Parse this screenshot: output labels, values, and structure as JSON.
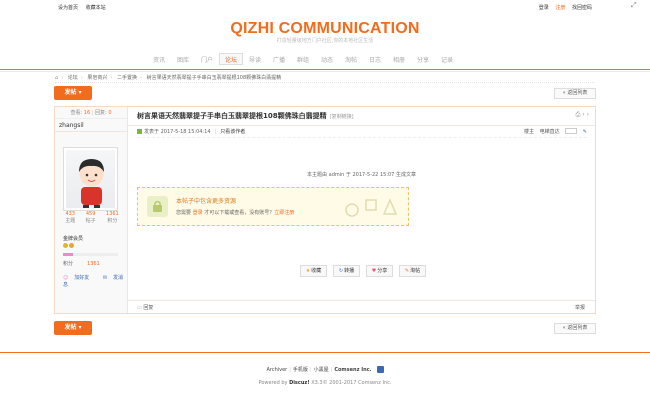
{
  "topbar": {
    "set_home": "设为首页",
    "favorite": "收藏本站",
    "login": "登录",
    "register": "注册",
    "forgot": "找回密码"
  },
  "brand": {
    "logo": "QIZHI COMMUNICATION",
    "tagline": "打造轻量级地方门户社区,你的本地社区生活"
  },
  "nav": [
    "资讯",
    "图库",
    "门户",
    "论坛",
    "导读",
    "广播",
    "群组",
    "动态",
    "淘帖",
    "日志",
    "相册",
    "分享",
    "记录"
  ],
  "nav_active": "论坛",
  "breadcrumb": [
    "论坛",
    "果皂商兴",
    "二手置换",
    "树言果语天然翡翠提子手串白玉翡翠提根108颗佛珠白翡提精"
  ],
  "buttons": {
    "post": "发帖",
    "back": "返回列表"
  },
  "sidebar": {
    "views_label": "查看:",
    "views": "16",
    "replies_label": "回复:",
    "replies": "0",
    "author": "zhangsil",
    "stats": [
      {
        "value": "433",
        "label": "主题"
      },
      {
        "value": "459",
        "label": "帖子"
      },
      {
        "value": "1361",
        "label": "积分"
      }
    ],
    "level": "金牌会员",
    "progress": 0.18,
    "points_label": "积分",
    "points": "1361",
    "add_friend": "加好友",
    "send_pm": "发消息"
  },
  "post": {
    "title": "树言果语天然翡翠提子手串白玉翡翠提根108颗佛珠白翡提精",
    "copy_link": "[复制链接]",
    "posted": "发表于 2017-5-18 15:04:14",
    "only_author": "只看该作者",
    "floor_label": "楼主",
    "goto_floor": "电梯直达",
    "edit_note": "本主题由 admin 于 2017-5-22 15:07 生成文章",
    "hidden_title": "本帖子中包含更多资源",
    "hidden_text_1": "您需要",
    "hidden_login": "登录",
    "hidden_text_2": "才可以下载或查看，没有账号？",
    "hidden_register": "立即注册",
    "actions": [
      {
        "icon": "star-icon",
        "label": "收藏"
      },
      {
        "icon": "share-icon",
        "label": "转播"
      },
      {
        "icon": "heart-icon",
        "label": "分享"
      },
      {
        "icon": "edit-icon",
        "label": "淘帖"
      }
    ],
    "reply": "回复",
    "report": "举报"
  },
  "footer": {
    "links": [
      "Archiver",
      "手机版",
      "小黑屋"
    ],
    "company": "Comsenz Inc.",
    "powered_prefix": "Powered by",
    "product": "Discuz!",
    "version_text": "X3.3© 2001-2017 Comsenz Inc."
  },
  "colors": {
    "accent": "#f26c1e",
    "link": "#3a6ab4",
    "hidden_box_bg": "#fffbe6"
  }
}
